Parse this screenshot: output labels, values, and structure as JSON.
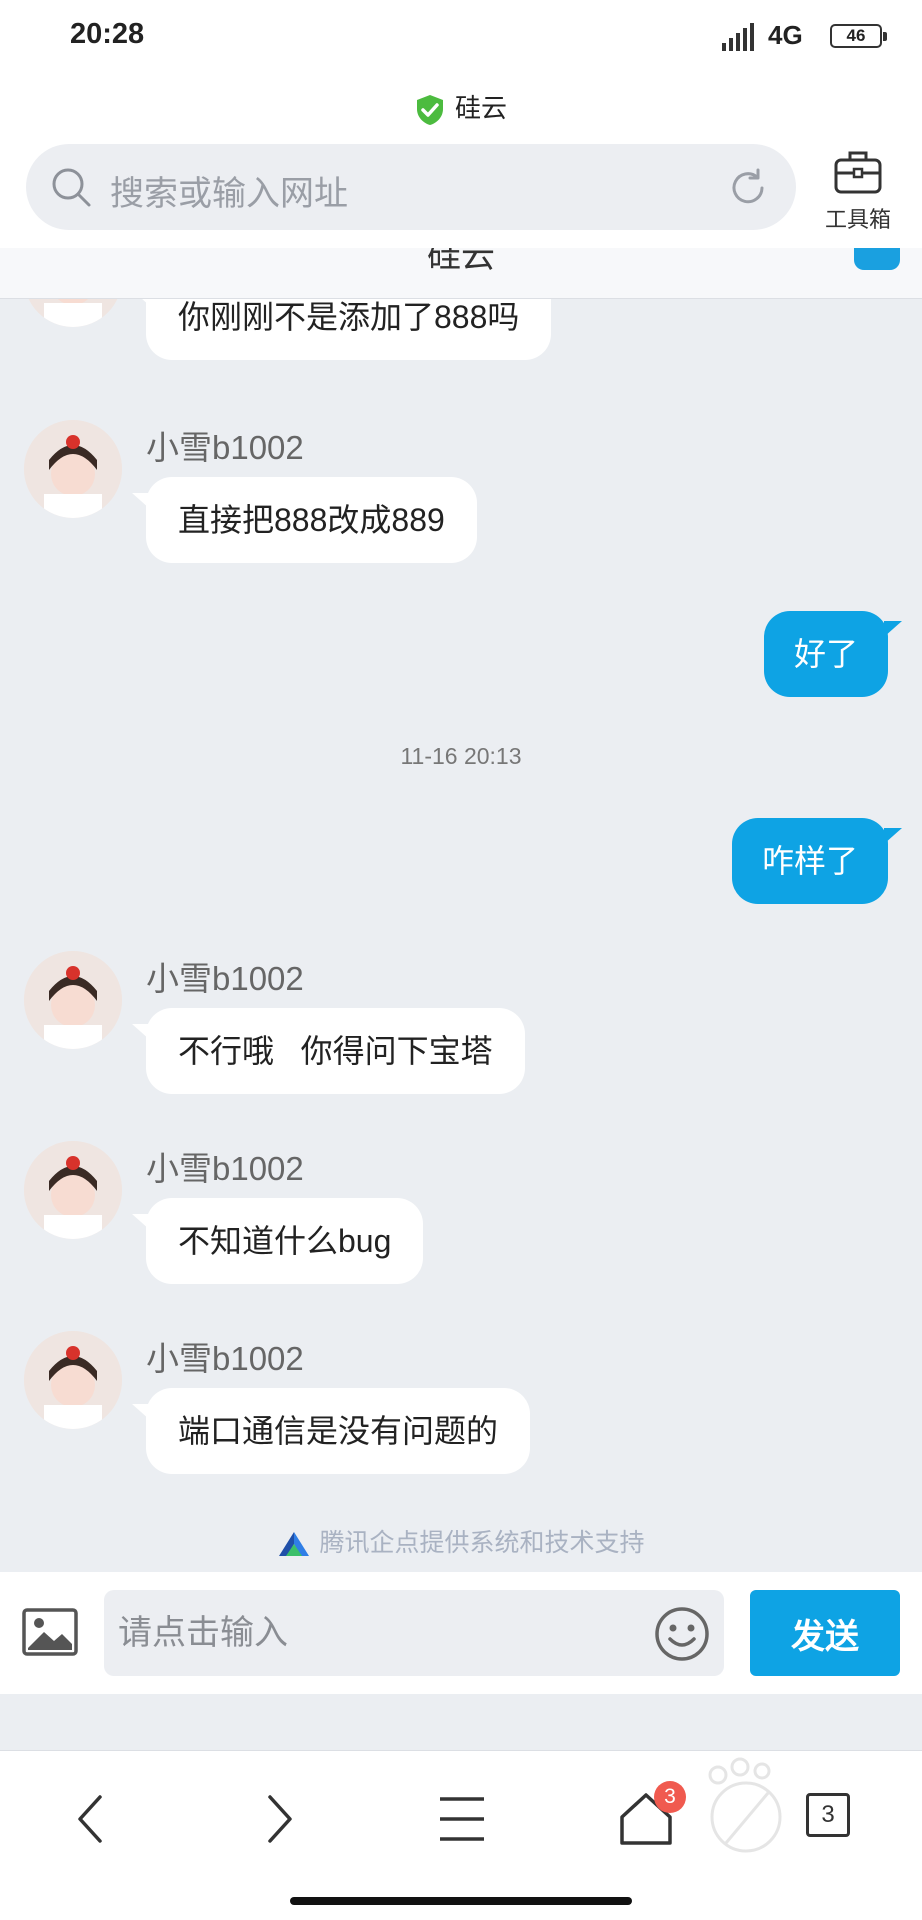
{
  "status_bar": {
    "time": "20:28",
    "network": "4G",
    "battery": "46"
  },
  "browser": {
    "site_title": "硅云",
    "address_placeholder": "搜索或输入网址",
    "toolbox_label": "工具箱"
  },
  "chat": {
    "header_title": "硅云",
    "messages": [
      {
        "side": "in",
        "text": "你刚刚不是添加了888吗"
      },
      {
        "side": "in",
        "sender": "小雪b1002",
        "text": "直接把888改成889"
      },
      {
        "side": "out",
        "text": "好了"
      },
      {
        "timestamp": "11-16 20:13"
      },
      {
        "side": "out",
        "text": "咋样了"
      },
      {
        "side": "in",
        "sender": "小雪b1002",
        "text": "不行哦   你得问下宝塔"
      },
      {
        "side": "in",
        "sender": "小雪b1002",
        "text": "不知道什么bug"
      },
      {
        "side": "in",
        "sender": "小雪b1002",
        "text": "端口通信是没有问题的"
      }
    ],
    "powered_by": "腾讯企点提供系统和技术支持"
  },
  "input_bar": {
    "placeholder": "请点击输入",
    "send_label": "发送"
  },
  "nav_bar": {
    "home_badge": "3",
    "tab_count": "3"
  },
  "colors": {
    "accent": "#0ea3e4",
    "badge": "#f05a4f",
    "chat_bg": "#ebeef2"
  },
  "icons": [
    "shield-check-icon",
    "search-icon",
    "reload-icon",
    "toolbox-icon",
    "image-icon",
    "emoji-icon",
    "back-icon",
    "forward-icon",
    "menu-icon",
    "home-icon",
    "tabs-icon"
  ]
}
